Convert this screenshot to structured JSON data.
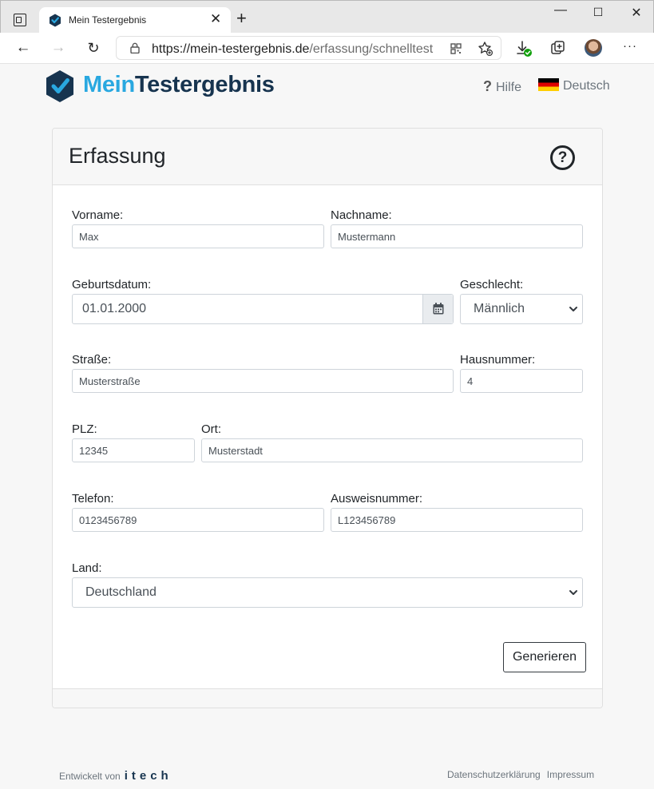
{
  "browser": {
    "tab_title": "Mein Testergebnis",
    "url_host": "https://mein-testergebnis.de",
    "url_path": "/erfassung/schnelltest"
  },
  "header": {
    "brand_part1": "Mein",
    "brand_part2": "Testergebnis",
    "help_label": "Hilfe",
    "language_label": "Deutsch"
  },
  "form": {
    "title": "Erfassung",
    "vorname": {
      "label": "Vorname:",
      "value": "Max"
    },
    "nachname": {
      "label": "Nachname:",
      "value": "Mustermann"
    },
    "geburtsdatum": {
      "label": "Geburtsdatum:",
      "value": "01.01.2000"
    },
    "geschlecht": {
      "label": "Geschlecht:",
      "value": "Männlich"
    },
    "strasse": {
      "label": "Straße:",
      "value": "Musterstraße"
    },
    "hausnummer": {
      "label": "Hausnummer:",
      "value": "4"
    },
    "plz": {
      "label": "PLZ:",
      "value": "12345"
    },
    "ort": {
      "label": "Ort:",
      "value": "Musterstadt"
    },
    "telefon": {
      "label": "Telefon:",
      "value": "0123456789"
    },
    "ausweisnummer": {
      "label": "Ausweisnummer:",
      "value": "L123456789"
    },
    "land": {
      "label": "Land:",
      "value": "Deutschland"
    },
    "submit_label": "Generieren"
  },
  "footer": {
    "developed_by": "Entwickelt von",
    "company": "itech",
    "privacy_label": "Datenschutzerklärung",
    "imprint_label": "Impressum"
  },
  "colors": {
    "brand_light": "#29a8e0",
    "brand_dark": "#17344f"
  }
}
